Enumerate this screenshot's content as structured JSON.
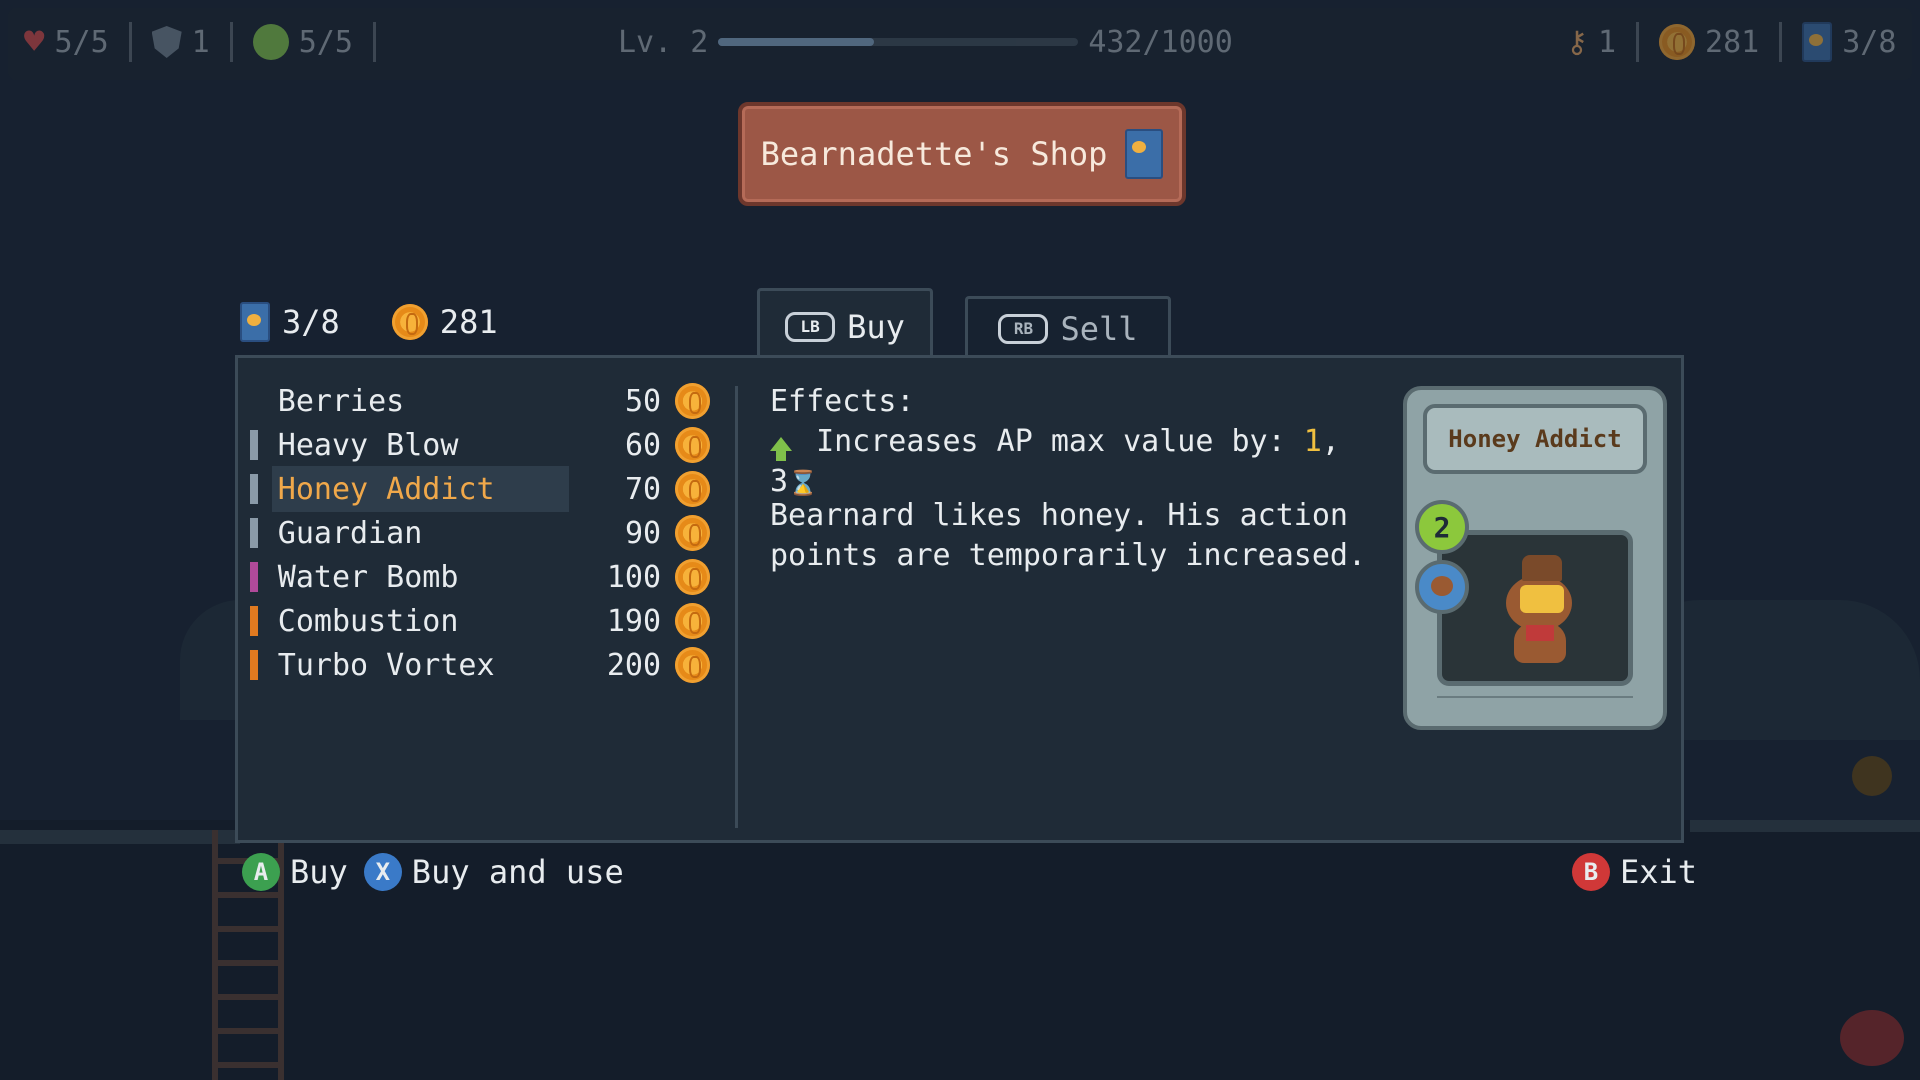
{
  "hud": {
    "health": "5/5",
    "armor": "1",
    "energy": "5/5",
    "level": "Lv. 2",
    "xp": "432/1000",
    "xp_fraction": 0.432,
    "keys": "1",
    "coins": "281",
    "cards": "3/8"
  },
  "shop": {
    "title": "Bearnadette's Shop"
  },
  "wallet": {
    "cards": "3/8",
    "coins": "281"
  },
  "tabs": [
    {
      "button": "LB",
      "label": "Buy",
      "active": true
    },
    {
      "button": "RB",
      "label": "Sell",
      "active": false
    }
  ],
  "items": [
    {
      "name": "Berries",
      "price": "50",
      "color": ""
    },
    {
      "name": "Heavy Blow",
      "price": "60",
      "color": "#8a9aa8"
    },
    {
      "name": "Honey Addict",
      "price": "70",
      "color": "#8a9aa8"
    },
    {
      "name": "Guardian",
      "price": "90",
      "color": "#8a9aa8"
    },
    {
      "name": "Water Bomb",
      "price": "100",
      "color": "#b04a9a"
    },
    {
      "name": "Combustion",
      "price": "190",
      "color": "#e07a20"
    },
    {
      "name": "Turbo Vortex",
      "price": "200",
      "color": "#e07a20"
    }
  ],
  "selected_index": 2,
  "details": {
    "effects_label": "Effects:",
    "effect_text": "Increases AP max value by:",
    "effect_value": "1",
    "effect_sep": ",",
    "effect_duration": "3",
    "description": "Bearnard likes honey. His action points are temporarily increased."
  },
  "card": {
    "name": "Honey Addict",
    "ap_cost": "2"
  },
  "controls": {
    "a_button": "A",
    "a_label": "Buy",
    "x_button": "X",
    "x_label": "Buy and use",
    "b_button": "B",
    "b_label": "Exit"
  },
  "colors": {
    "selected_text": "#f0a84a",
    "panel": "#1f2b37",
    "shop_title_bg": "#9c5746"
  }
}
